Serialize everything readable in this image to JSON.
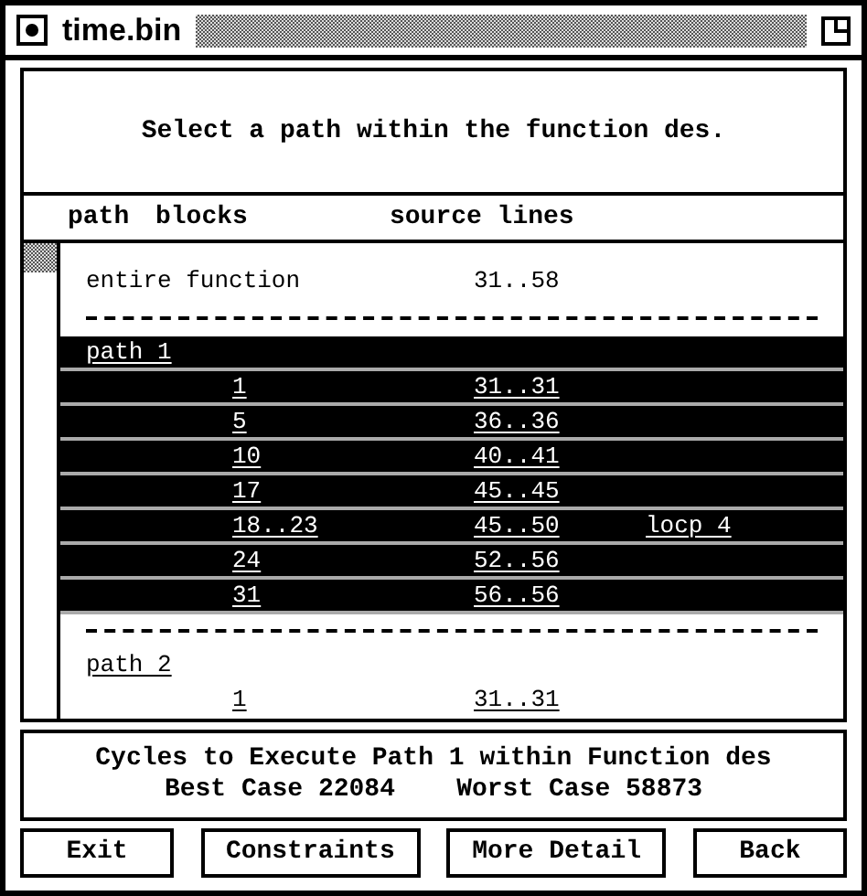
{
  "window": {
    "title": "time.bin"
  },
  "prompt": "Select a path within the function des.",
  "columns": [
    "path",
    "blocks",
    "source lines"
  ],
  "rows": [
    {
      "kind": "function",
      "label": "entire function",
      "lines": "31..58",
      "selected": false
    },
    {
      "kind": "separator"
    },
    {
      "kind": "path",
      "label": "path 1",
      "selected": true
    },
    {
      "kind": "block",
      "blocks": "1",
      "lines": "31..31",
      "selected": true
    },
    {
      "kind": "block",
      "blocks": "5",
      "lines": "36..36",
      "selected": true
    },
    {
      "kind": "block",
      "blocks": "10",
      "lines": "40..41",
      "selected": true
    },
    {
      "kind": "block",
      "blocks": "17",
      "lines": "45..45",
      "selected": true
    },
    {
      "kind": "block",
      "blocks": "18..23",
      "lines": "45..50",
      "note": "locp 4",
      "selected": true
    },
    {
      "kind": "block",
      "blocks": "24",
      "lines": "52..56",
      "selected": true
    },
    {
      "kind": "block",
      "blocks": "31",
      "lines": "56..56",
      "selected": true
    },
    {
      "kind": "separator"
    },
    {
      "kind": "path",
      "label": "path 2",
      "selected": false
    },
    {
      "kind": "block",
      "blocks": "1",
      "lines": "31..31",
      "selected": false
    }
  ],
  "summary": [
    "Cycles to Execute Path 1 within Function des",
    "Best Case 22084    Worst Case 58873"
  ],
  "buttons": [
    "Exit",
    "Constraints",
    "More Detail",
    "Back"
  ]
}
